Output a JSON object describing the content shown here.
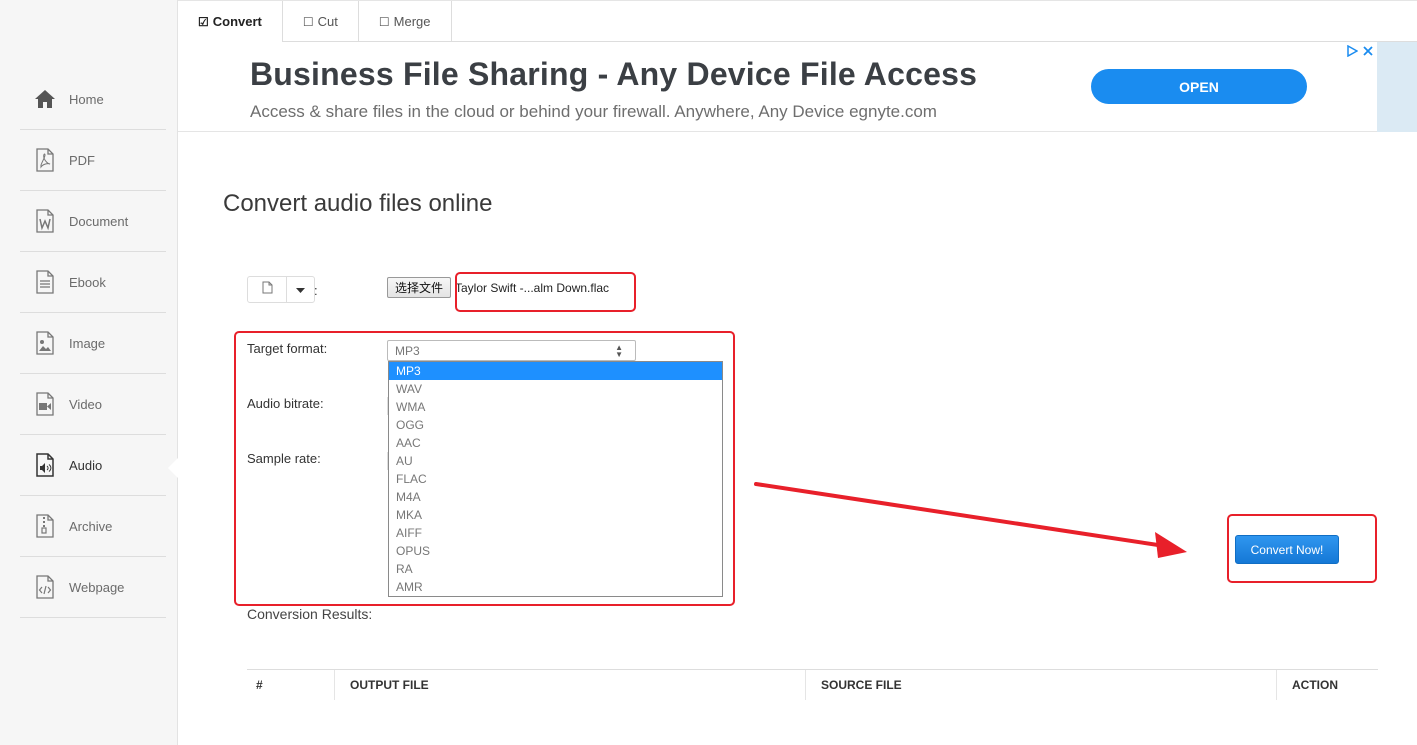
{
  "sidebar": {
    "items": [
      {
        "label": "Home",
        "icon": "home-icon"
      },
      {
        "label": "PDF",
        "icon": "pdf-icon"
      },
      {
        "label": "Document",
        "icon": "document-icon"
      },
      {
        "label": "Ebook",
        "icon": "ebook-icon"
      },
      {
        "label": "Image",
        "icon": "image-icon"
      },
      {
        "label": "Video",
        "icon": "video-icon"
      },
      {
        "label": "Audio",
        "icon": "audio-icon",
        "active": true
      },
      {
        "label": "Archive",
        "icon": "archive-icon"
      },
      {
        "label": "Webpage",
        "icon": "webpage-icon"
      }
    ]
  },
  "tabs": [
    {
      "label": "Convert",
      "checked": true
    },
    {
      "label": "Cut",
      "checked": false
    },
    {
      "label": "Merge",
      "checked": false
    }
  ],
  "ad": {
    "title": "Business File Sharing - Any Device File Access",
    "subtitle": "Access & share files in the cloud or behind your firewall. Anywhere, Any Device egnyte.com",
    "button": "OPEN"
  },
  "page": {
    "title": "Convert audio files online"
  },
  "file": {
    "colon": ":",
    "choose_label": "选择文件",
    "file_name": "Taylor Swift -...alm Down.flac"
  },
  "form": {
    "target_format_label": "Target format:",
    "audio_bitrate_label": "Audio bitrate:",
    "sample_rate_label": "Sample rate:",
    "selected_format": "MP3",
    "format_options": [
      "MP3",
      "WAV",
      "WMA",
      "OGG",
      "AAC",
      "AU",
      "FLAC",
      "M4A",
      "MKA",
      "AIFF",
      "OPUS",
      "RA",
      "AMR"
    ]
  },
  "convert_button": "Convert Now!",
  "results": {
    "label": "Conversion Results:",
    "columns": [
      "#",
      "OUTPUT FILE",
      "SOURCE FILE",
      "ACTION"
    ]
  },
  "colors": {
    "accent": "#1a8cf0",
    "annotation_red": "#e8202a",
    "selected_option": "#1e90ff"
  }
}
